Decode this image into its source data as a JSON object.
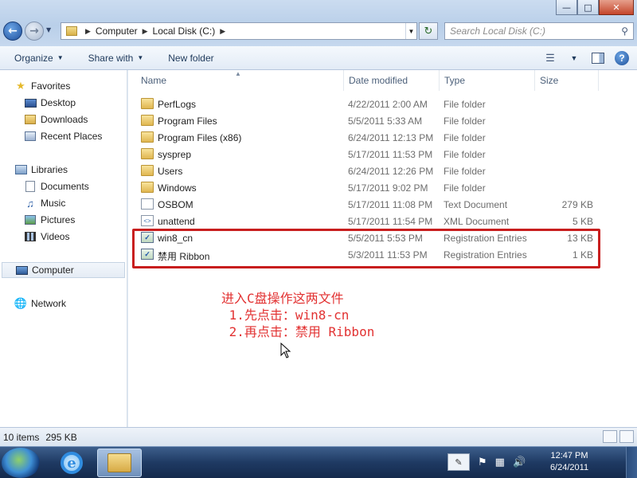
{
  "window": {
    "controls": [
      "minimize",
      "maximize",
      "close"
    ]
  },
  "address": {
    "crumbs": [
      "Computer",
      "Local Disk (C:)"
    ]
  },
  "search": {
    "placeholder": "Search Local Disk (C:)"
  },
  "toolbar": {
    "organize": "Organize",
    "share_with": "Share with",
    "new_folder": "New folder"
  },
  "nav": {
    "favorites": {
      "label": "Favorites",
      "items": [
        {
          "label": "Desktop",
          "icon": "desktop-icon"
        },
        {
          "label": "Downloads",
          "icon": "downloads-icon"
        },
        {
          "label": "Recent Places",
          "icon": "recent-places-icon"
        }
      ]
    },
    "libraries": {
      "label": "Libraries",
      "items": [
        {
          "label": "Documents",
          "icon": "documents-icon"
        },
        {
          "label": "Music",
          "icon": "music-icon"
        },
        {
          "label": "Pictures",
          "icon": "pictures-icon"
        },
        {
          "label": "Videos",
          "icon": "videos-icon"
        }
      ]
    },
    "computer": {
      "label": "Computer"
    },
    "network": {
      "label": "Network"
    }
  },
  "columns": {
    "name": "Name",
    "date": "Date modified",
    "type": "Type",
    "size": "Size"
  },
  "files": [
    {
      "name": "PerfLogs",
      "date": "4/22/2011 2:00 AM",
      "type": "File folder",
      "size": "",
      "icon": "folder-icon"
    },
    {
      "name": "Program Files",
      "date": "5/5/2011 5:33 AM",
      "type": "File folder",
      "size": "",
      "icon": "folder-icon"
    },
    {
      "name": "Program Files (x86)",
      "date": "6/24/2011 12:13 PM",
      "type": "File folder",
      "size": "",
      "icon": "folder-icon"
    },
    {
      "name": "sysprep",
      "date": "5/17/2011 11:53 PM",
      "type": "File folder",
      "size": "",
      "icon": "folder-icon"
    },
    {
      "name": "Users",
      "date": "6/24/2011 12:26 PM",
      "type": "File folder",
      "size": "",
      "icon": "folder-icon"
    },
    {
      "name": "Windows",
      "date": "5/17/2011 9:02 PM",
      "type": "File folder",
      "size": "",
      "icon": "folder-icon"
    },
    {
      "name": "OSBOM",
      "date": "5/17/2011 11:08 PM",
      "type": "Text Document",
      "size": "279 KB",
      "icon": "text-document-icon"
    },
    {
      "name": "unattend",
      "date": "5/17/2011 11:54 PM",
      "type": "XML Document",
      "size": "5 KB",
      "icon": "xml-document-icon"
    },
    {
      "name": "win8_cn",
      "date": "5/5/2011 5:53 PM",
      "type": "Registration Entries",
      "size": "13 KB",
      "icon": "registry-file-icon"
    },
    {
      "name": "禁用 Ribbon",
      "date": "5/3/2011 11:53 PM",
      "type": "Registration Entries",
      "size": "1 KB",
      "icon": "registry-file-icon"
    }
  ],
  "annotation": {
    "line1": "进入C盘操作这两文件",
    "line2": " 1.先点击：win8-cn",
    "line3": " 2.再点击：禁用 Ribbon",
    "color": "#e23232"
  },
  "status": {
    "items": "10 items",
    "size": "295 KB"
  },
  "clock": {
    "time": "12:47 PM",
    "date": "6/24/2011"
  },
  "highlight_color": "#c81e1e"
}
